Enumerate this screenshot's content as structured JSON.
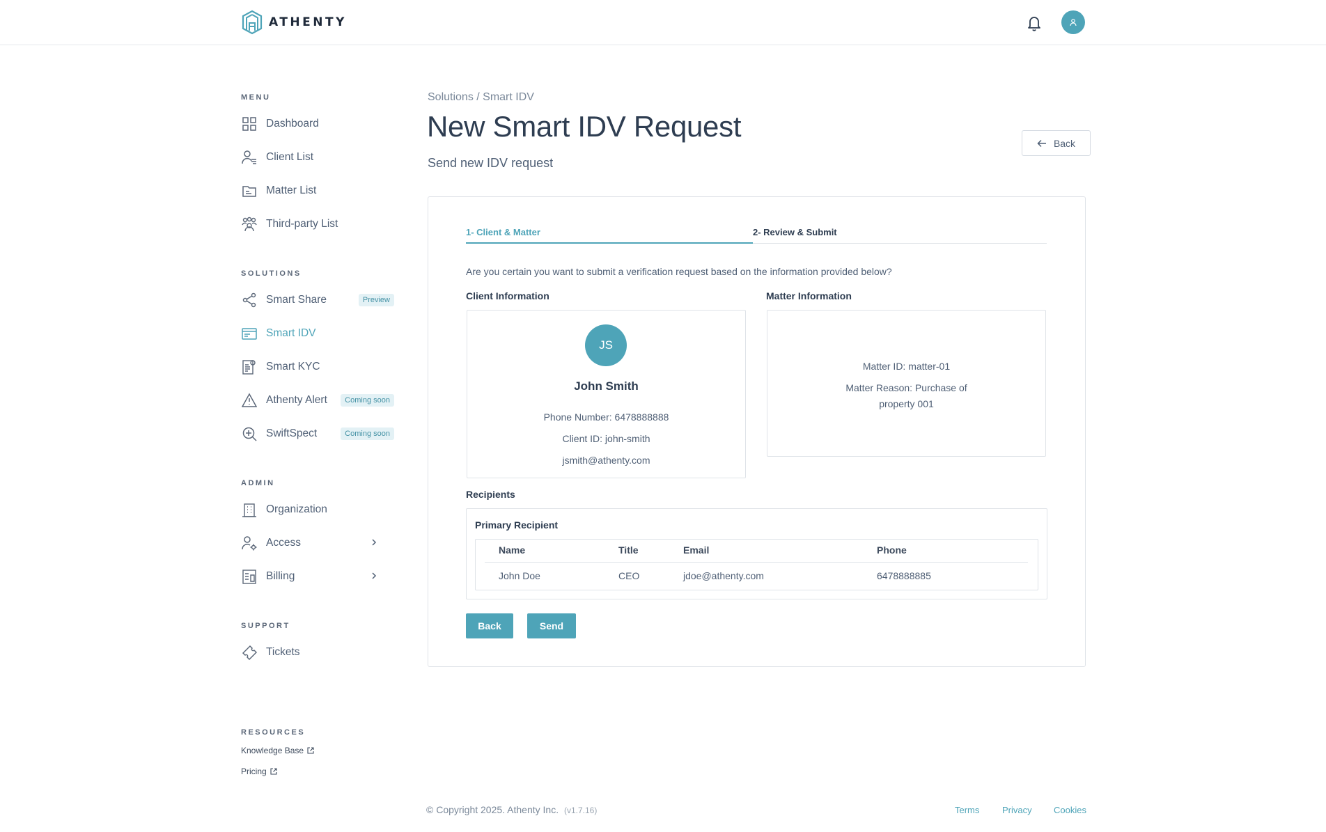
{
  "app": {
    "brand": "ATHENTY"
  },
  "sidebar": {
    "menu_title": "MENU",
    "menu": [
      {
        "label": "Dashboard"
      },
      {
        "label": "Client List"
      },
      {
        "label": "Matter List"
      },
      {
        "label": "Third-party List"
      }
    ],
    "solutions_title": "SOLUTIONS",
    "solutions": [
      {
        "label": "Smart Share",
        "badge": "Preview"
      },
      {
        "label": "Smart IDV",
        "active": true
      },
      {
        "label": "Smart KYC"
      },
      {
        "label": "Athenty Alert",
        "badge": "Coming soon"
      },
      {
        "label": "SwiftSpect",
        "badge": "Coming soon"
      }
    ],
    "admin_title": "ADMIN",
    "admin": [
      {
        "label": "Organization"
      },
      {
        "label": "Access"
      },
      {
        "label": "Billing"
      }
    ],
    "support_title": "SUPPORT",
    "support": [
      {
        "label": "Tickets"
      }
    ],
    "resources_title": "RESOURCES",
    "resources": [
      {
        "label": "Knowledge Base"
      },
      {
        "label": "Pricing"
      }
    ]
  },
  "main": {
    "breadcrumb": "Solutions / Smart IDV",
    "title": "New Smart IDV Request",
    "subtitle": "Send new IDV request",
    "back_label": "Back",
    "steps": [
      {
        "label": "1- Client & Matter"
      },
      {
        "label": "2- Review & Submit"
      }
    ],
    "question": "Are you certain you want to submit a verification request based on the information provided below?",
    "client_info": {
      "heading": "Client Information",
      "initials": "JS",
      "name": "John Smith",
      "phone": "Phone Number: 6478888888",
      "client_id": "Client ID: john-smith",
      "email": "jsmith@athenty.com"
    },
    "matter_info": {
      "heading": "Matter Information",
      "matter_id": "Matter ID: matter-01",
      "matter_reason_line1": "Matter Reason: Purchase of",
      "matter_reason_line2": "property 001"
    },
    "recipients": {
      "heading": "Recipients",
      "primary_heading": "Primary Recipient",
      "columns": {
        "name": "Name",
        "title": "Title",
        "email": "Email",
        "phone": "Phone"
      },
      "rows": [
        {
          "name": "John Doe",
          "title": "CEO",
          "email": "jdoe@athenty.com",
          "phone": "6478888885"
        }
      ]
    },
    "back_button": "Back",
    "send_button": "Send"
  },
  "footer": {
    "copyright": "© Copyright 2025. Athenty Inc.",
    "version": "(v1.7.16)",
    "links": [
      {
        "label": "Terms"
      },
      {
        "label": "Privacy"
      },
      {
        "label": "Cookies"
      }
    ]
  },
  "colors": {
    "accent": "#4ea4b8",
    "text": "#3d4a5c",
    "border": "#dfe3e8"
  }
}
